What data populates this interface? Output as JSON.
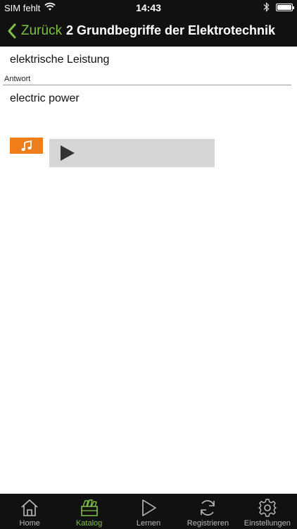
{
  "status": {
    "carrier": "SIM fehlt",
    "time": "14:43"
  },
  "nav": {
    "back_label": "Zurück",
    "title": "2 Grundbegriffe der Elektrotechnik"
  },
  "card": {
    "question": "elektrische Leistung",
    "answer_label": "Antwort",
    "answer": "electric power"
  },
  "tabs": [
    {
      "label": "Home",
      "icon": "home-icon"
    },
    {
      "label": "Katalog",
      "icon": "catalog-icon"
    },
    {
      "label": "Lernen",
      "icon": "play-icon"
    },
    {
      "label": "Registrieren",
      "icon": "sync-icon"
    },
    {
      "label": "Einstellungen",
      "icon": "gear-icon"
    }
  ],
  "colors": {
    "accent": "#7dc242",
    "audio_badge": "#ef7d1a",
    "bar_background": "#111111",
    "player_background": "#d6d6d6"
  }
}
